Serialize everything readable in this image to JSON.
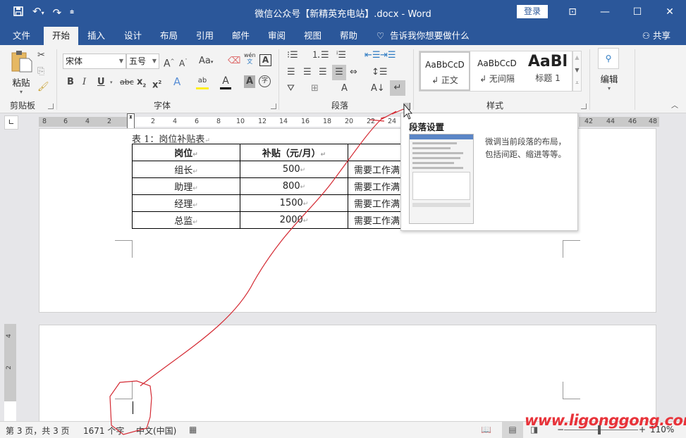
{
  "titlebar": {
    "title": "微信公众号【新精英充电站】.docx  -  Word",
    "login_label": "登录",
    "qat_icons": [
      "save-icon",
      "undo-icon",
      "redo-icon",
      "customize-qat-icon"
    ],
    "window_buttons": [
      "ribbon-display-options",
      "minimize",
      "maximize",
      "close"
    ]
  },
  "tabs": [
    {
      "label": "文件"
    },
    {
      "label": "开始",
      "active": true
    },
    {
      "label": "插入"
    },
    {
      "label": "设计"
    },
    {
      "label": "布局"
    },
    {
      "label": "引用"
    },
    {
      "label": "邮件"
    },
    {
      "label": "审阅"
    },
    {
      "label": "视图"
    },
    {
      "label": "帮助"
    }
  ],
  "tell_me": "告诉我你想要做什么",
  "share_label": "共享",
  "ribbon": {
    "clipboard": {
      "label": "剪贴板",
      "paste_label": "粘贴"
    },
    "font": {
      "label": "字体",
      "font_name": "宋体",
      "font_size": "五号",
      "change_case": "Aa",
      "phonetic": "wén",
      "phonetic_sub": "文"
    },
    "paragraph": {
      "label": "段落"
    },
    "styles": {
      "label": "样式",
      "items": [
        {
          "sample": "AaBbCcD",
          "name": "↲ 正文"
        },
        {
          "sample": "AaBbCcD",
          "name": "↲ 无间隔"
        },
        {
          "sample": "AaBl",
          "name": "标题 1"
        }
      ]
    },
    "editing": {
      "label": "编辑"
    }
  },
  "ruler": {
    "left_ticks": [
      "8",
      "6",
      "4",
      "2"
    ],
    "right_ticks": [
      "2",
      "4",
      "6",
      "8",
      "10",
      "12",
      "14",
      "16",
      "18",
      "20",
      "22",
      "24"
    ],
    "far_ticks": [
      "42",
      "44",
      "46",
      "48"
    ],
    "vertical_ticks": [
      "4",
      "2"
    ]
  },
  "document": {
    "caption": "表 1：岗位补贴表",
    "table": {
      "headers": [
        "岗位",
        "补贴（元/月）",
        ""
      ],
      "rows": [
        [
          "组长",
          "500",
          "需要工作满"
        ],
        [
          "助理",
          "800",
          "需要工作满"
        ],
        [
          "经理",
          "1500",
          "需要工作满"
        ],
        [
          "总监",
          "2000",
          "需要工作满"
        ]
      ]
    }
  },
  "tooltip": {
    "title": "段落设置",
    "description": "微调当前段落的布局，包括间距、缩进等等。"
  },
  "statusbar": {
    "page_info": "第 3 页，共 3 页",
    "word_count": "1671 个字",
    "language": "中文(中国)",
    "zoom_level": "110%"
  },
  "watermark": "www.ligonggong.com",
  "colors": {
    "brand": "#2b579a",
    "annotation": "#d42a33",
    "watermark": "#e8333a"
  }
}
